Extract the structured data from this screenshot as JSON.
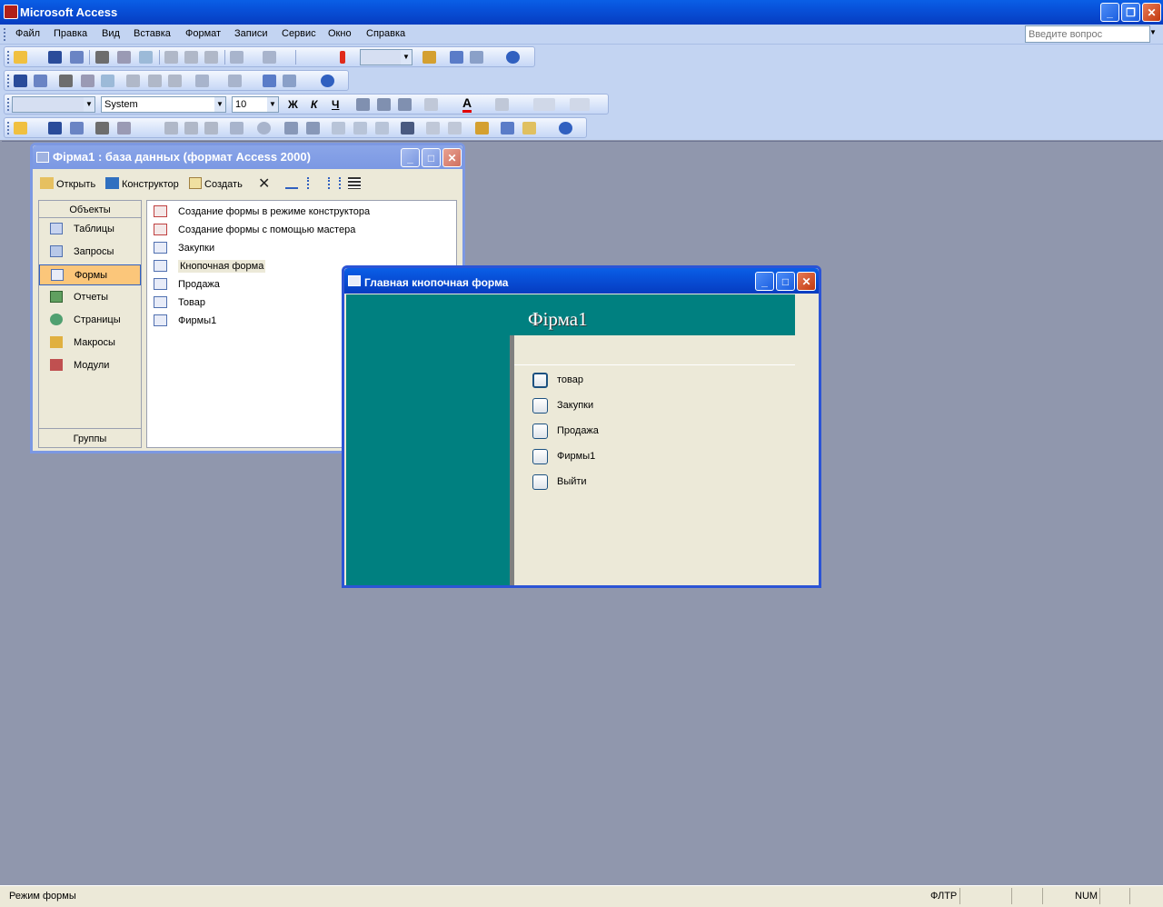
{
  "app": {
    "title": "Microsoft Access"
  },
  "menu": {
    "items": [
      "Файл",
      "Правка",
      "Вид",
      "Вставка",
      "Формат",
      "Записи",
      "Сервис",
      "Окно",
      "Справка"
    ],
    "help_placeholder": "Введите вопрос"
  },
  "format_toolbar": {
    "font": "System",
    "size": "10",
    "bold": "Ж",
    "italic": "К",
    "underline": "Ч"
  },
  "db_window": {
    "title": "Фірма1 : база данных (формат Access 2000)",
    "toolbar": {
      "open": "Открыть",
      "design": "Конструктор",
      "create": "Создать"
    },
    "objects_header": "Объекты",
    "objects": [
      "Таблицы",
      "Запросы",
      "Формы",
      "Отчеты",
      "Страницы",
      "Макросы",
      "Модули"
    ],
    "selected_object": "Формы",
    "groups_label": "Группы",
    "list": [
      "Создание формы в режиме конструктора",
      "Создание формы с помощью мастера",
      "Закупки",
      "Кнопочная форма",
      "Продажа",
      "Товар",
      "Фирмы1"
    ],
    "selected_item": "Кнопочная форма"
  },
  "switchboard": {
    "title": "Главная кнопочная форма",
    "header": "Фірма1",
    "buttons": [
      "товар",
      "Закупки",
      "Продажа",
      "Фирмы1",
      "Выйти"
    ],
    "teal_color": "#008080"
  },
  "status": {
    "mode": "Режим формы",
    "filter": "ФЛТР",
    "num": "NUM"
  }
}
